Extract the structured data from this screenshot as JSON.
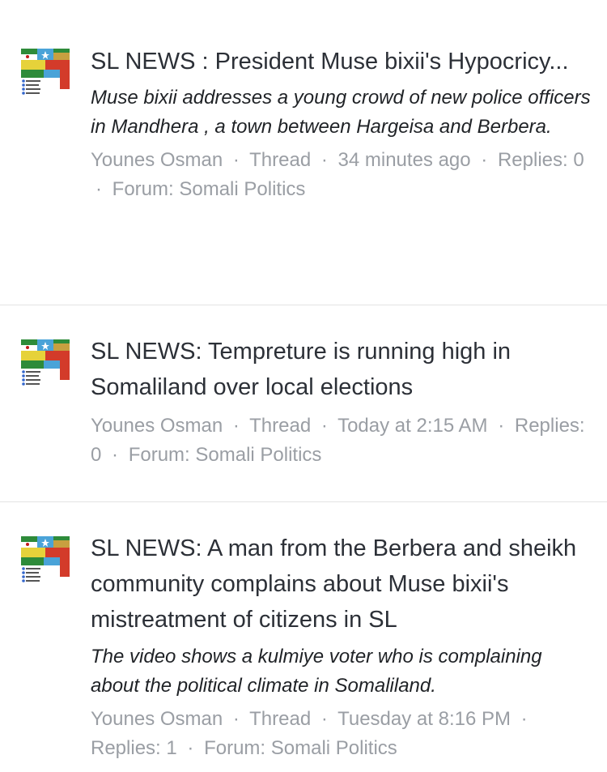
{
  "threads": [
    {
      "avatar_icon": "flag-collage-avatar-icon",
      "title": "SL NEWS : President Muse bixii's Hypocricy...",
      "snippet": "Muse bixii addresses a young crowd of new police officers in Mandhera , a town between Hargeisa and Berbera.",
      "author": "Younes Osman",
      "type": "Thread",
      "time": "34 minutes ago",
      "replies": "Replies: 0",
      "forum": "Forum: Somali Politics"
    },
    {
      "avatar_icon": "flag-collage-avatar-icon",
      "title": "SL NEWS: Tempreture is running high in Somaliland over local elections",
      "snippet": "",
      "author": "Younes Osman",
      "type": "Thread",
      "time": "Today at 2:15 AM",
      "replies": "Replies: 0",
      "forum": "Forum: Somali Politics"
    },
    {
      "avatar_icon": "flag-collage-avatar-icon",
      "title": "SL NEWS: A man from the Berbera and sheikh community complains about Muse bixii's mistreatment of citizens in SL",
      "snippet": "The video shows a kulmiye voter who is complaining about the political climate in Somaliland.",
      "author": "Younes Osman",
      "type": "Thread",
      "time": "Tuesday at 8:16 PM",
      "replies": "Replies: 1",
      "forum": "Forum: Somali Politics"
    }
  ],
  "meta_separator": "·"
}
